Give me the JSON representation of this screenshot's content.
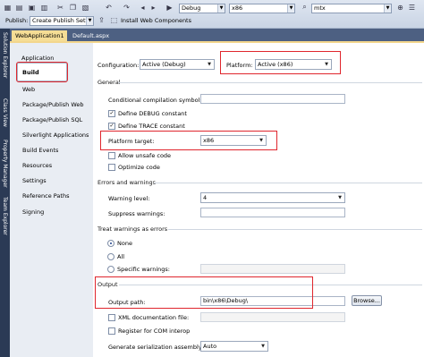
{
  "toolbar": {
    "publish_label": "Publish:",
    "publish_combo": "Create Publish Settings",
    "install_label": "Install Web Components",
    "config_combo": "Debug",
    "platform_combo": "x86",
    "find_combo": "mtx"
  },
  "side_tabs": [
    "Solution Explorer",
    "Class View",
    "Property Manager",
    "Team Explorer"
  ],
  "doc_tabs": [
    {
      "label": "WebApplication1"
    },
    {
      "label": "Default.aspx"
    }
  ],
  "nav": [
    "Application",
    "Build",
    "Web",
    "Package/Publish Web",
    "Package/Publish SQL",
    "Silverlight Applications",
    "Build Events",
    "Resources",
    "Settings",
    "Reference Paths",
    "Signing"
  ],
  "config": {
    "configuration_label": "Configuration:",
    "configuration_value": "Active (Debug)",
    "platform_label": "Platform:",
    "platform_value": "Active (x86)"
  },
  "general": {
    "title": "General",
    "conditional_label": "Conditional compilation symbols:",
    "conditional_value": "",
    "define_debug": "Define DEBUG constant",
    "define_trace": "Define TRACE constant",
    "platform_target_label": "Platform target:",
    "platform_target_value": "x86",
    "allow_unsafe": "Allow unsafe code",
    "optimize": "Optimize code"
  },
  "errors": {
    "title": "Errors and warnings",
    "warning_level_label": "Warning level:",
    "warning_level_value": "4",
    "suppress_label": "Suppress warnings:",
    "suppress_value": ""
  },
  "treat": {
    "title": "Treat warnings as errors",
    "none": "None",
    "all": "All",
    "specific": "Specific warnings:"
  },
  "output": {
    "title": "Output",
    "output_path_label": "Output path:",
    "output_path_value": "bin\\x86\\Debug\\",
    "browse": "Browse...",
    "xml_doc": "XML documentation file:",
    "register_com": "Register for COM interop",
    "serialization_label": "Generate serialization assembly:",
    "serialization_value": "Auto"
  },
  "colors": {
    "highlight": "#e0262d",
    "sidepanel": "#2b3a55",
    "doctab_bar": "#4d6082"
  }
}
